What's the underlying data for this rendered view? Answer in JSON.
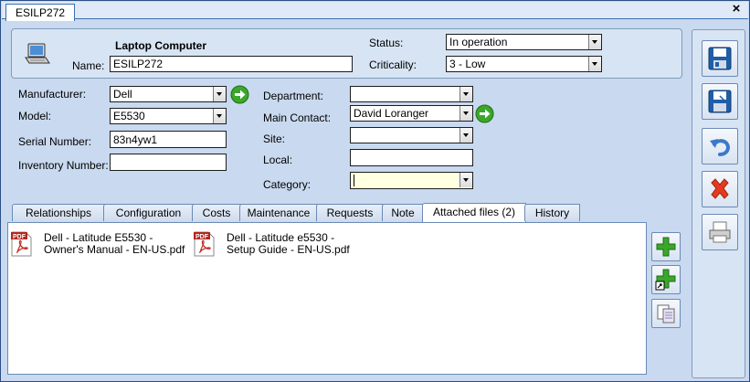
{
  "window": {
    "tab_title": "ESILP272",
    "close_glyph": "×"
  },
  "header": {
    "type_label": "Laptop Computer",
    "name_label": "Name:",
    "name_value": "ESILP272",
    "status_label": "Status:",
    "status_value": "In operation",
    "criticality_label": "Criticality:",
    "criticality_value": "3 - Low",
    "icon": "laptop-icon"
  },
  "form": {
    "manufacturer_label": "Manufacturer:",
    "manufacturer_value": "Dell",
    "model_label": "Model:",
    "model_value": "E5530",
    "serial_label": "Serial Number:",
    "serial_value": "83n4yw1",
    "inventory_label": "Inventory Number:",
    "inventory_value": "",
    "department_label": "Department:",
    "department_value": "",
    "main_contact_label": "Main Contact:",
    "main_contact_value": "David Loranger",
    "site_label": "Site:",
    "site_value": "",
    "local_label": "Local:",
    "local_value": "",
    "category_label": "Category:",
    "category_value": ""
  },
  "tabs": [
    {
      "label": "Relationships"
    },
    {
      "label": "Configuration"
    },
    {
      "label": "Costs"
    },
    {
      "label": "Maintenance"
    },
    {
      "label": "Requests"
    },
    {
      "label": "Note"
    },
    {
      "label": "Attached files (2)"
    },
    {
      "label": "History"
    }
  ],
  "active_tab": "Attached files (2)",
  "files": [
    {
      "name": "Dell - Latitude E5530 - Owner's Manual - EN-US.pdf",
      "icon": "pdf-icon"
    },
    {
      "name": "Dell - Latitude e5530 - Setup Guide - EN-US.pdf",
      "icon": "pdf-icon"
    }
  ],
  "file_actions": [
    "add-file-icon",
    "add-shortcut-icon",
    "copy-files-icon"
  ],
  "toolbar": [
    "save-icon",
    "save-as-icon",
    "undo-icon",
    "delete-icon",
    "print-icon"
  ],
  "colors": {
    "accent": "#3b6fb3",
    "panel": "#d7e4f4",
    "green": "#3aa72a",
    "red": "#e23b1f",
    "category_bg": "#ffffe1"
  }
}
